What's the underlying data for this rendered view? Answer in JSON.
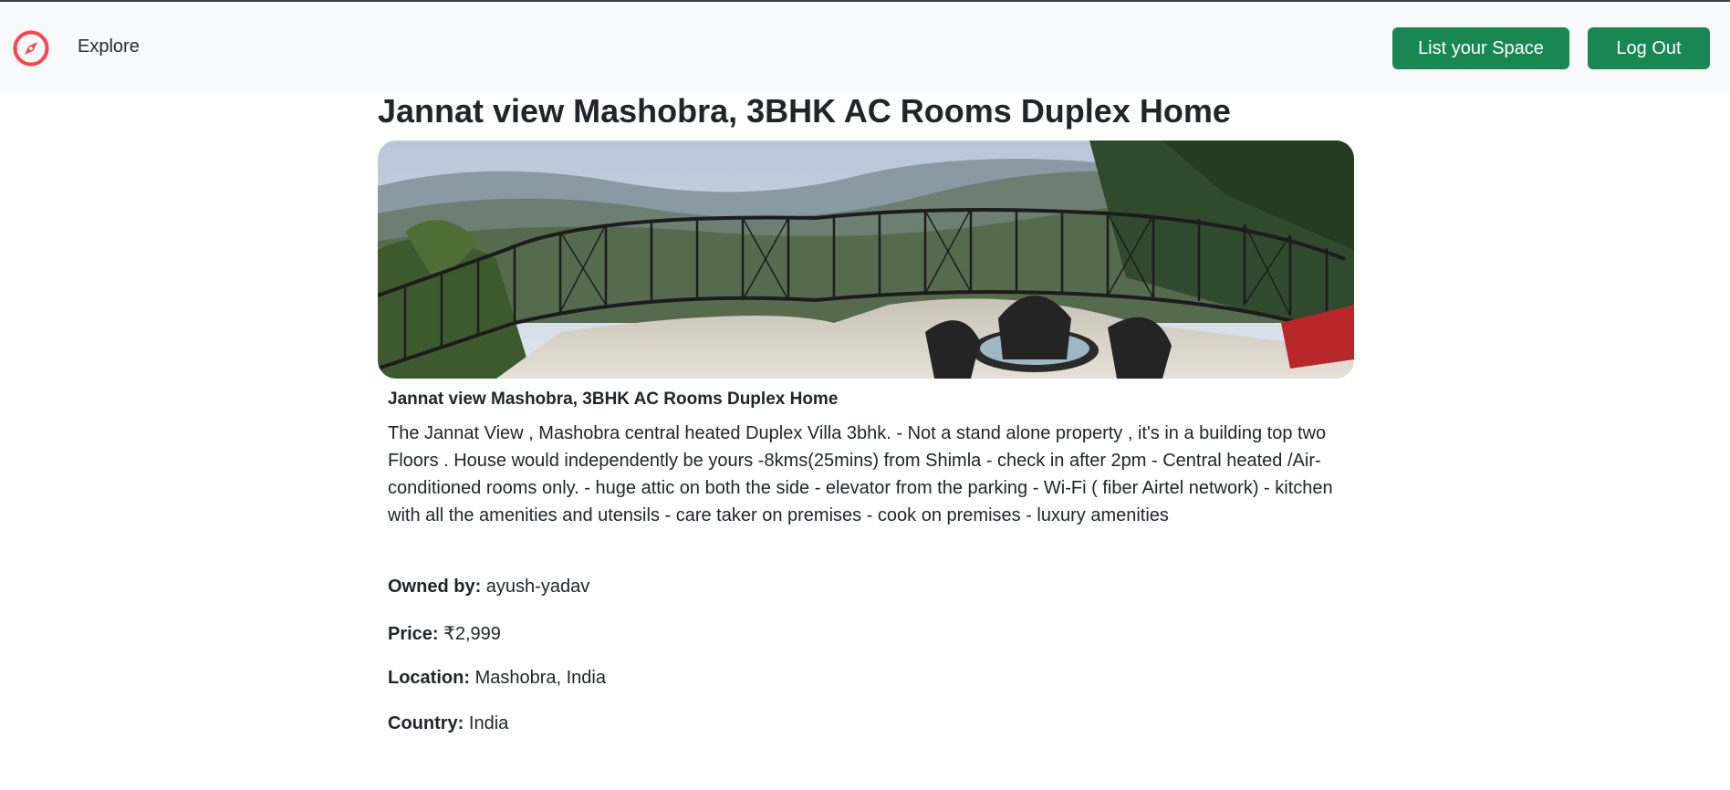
{
  "nav": {
    "brand_icon": "compass-icon",
    "explore_label": "Explore",
    "list_space_label": "List your Space",
    "logout_label": "Log Out",
    "brand_color": "#fe424d",
    "button_color": "#198754"
  },
  "listing": {
    "heading": "Jannat view Mashobra, 3BHK AC Rooms Duplex Home",
    "card_title": "Jannat view Mashobra, 3BHK AC Rooms Duplex Home",
    "description": "The Jannat View , Mashobra central heated Duplex Villa 3bhk. - Not a stand alone property , it's in a building top two Floors . House would independently be yours -8kms(25mins) from Shimla - check in after 2pm - Central heated /Air-conditioned rooms only. - huge attic on both the side - elevator from the parking - Wi-Fi ( fiber Airtel network) - kitchen with all the amenities and utensils - care taker on premises - cook on premises - luxury amenities",
    "owner_label": "Owned by:",
    "owner": "ayush-yadav",
    "price_label": "Price:",
    "price": "₹2,999",
    "location_label": "Location:",
    "location": "Mashobra, India",
    "country_label": "Country:",
    "country": "India"
  }
}
